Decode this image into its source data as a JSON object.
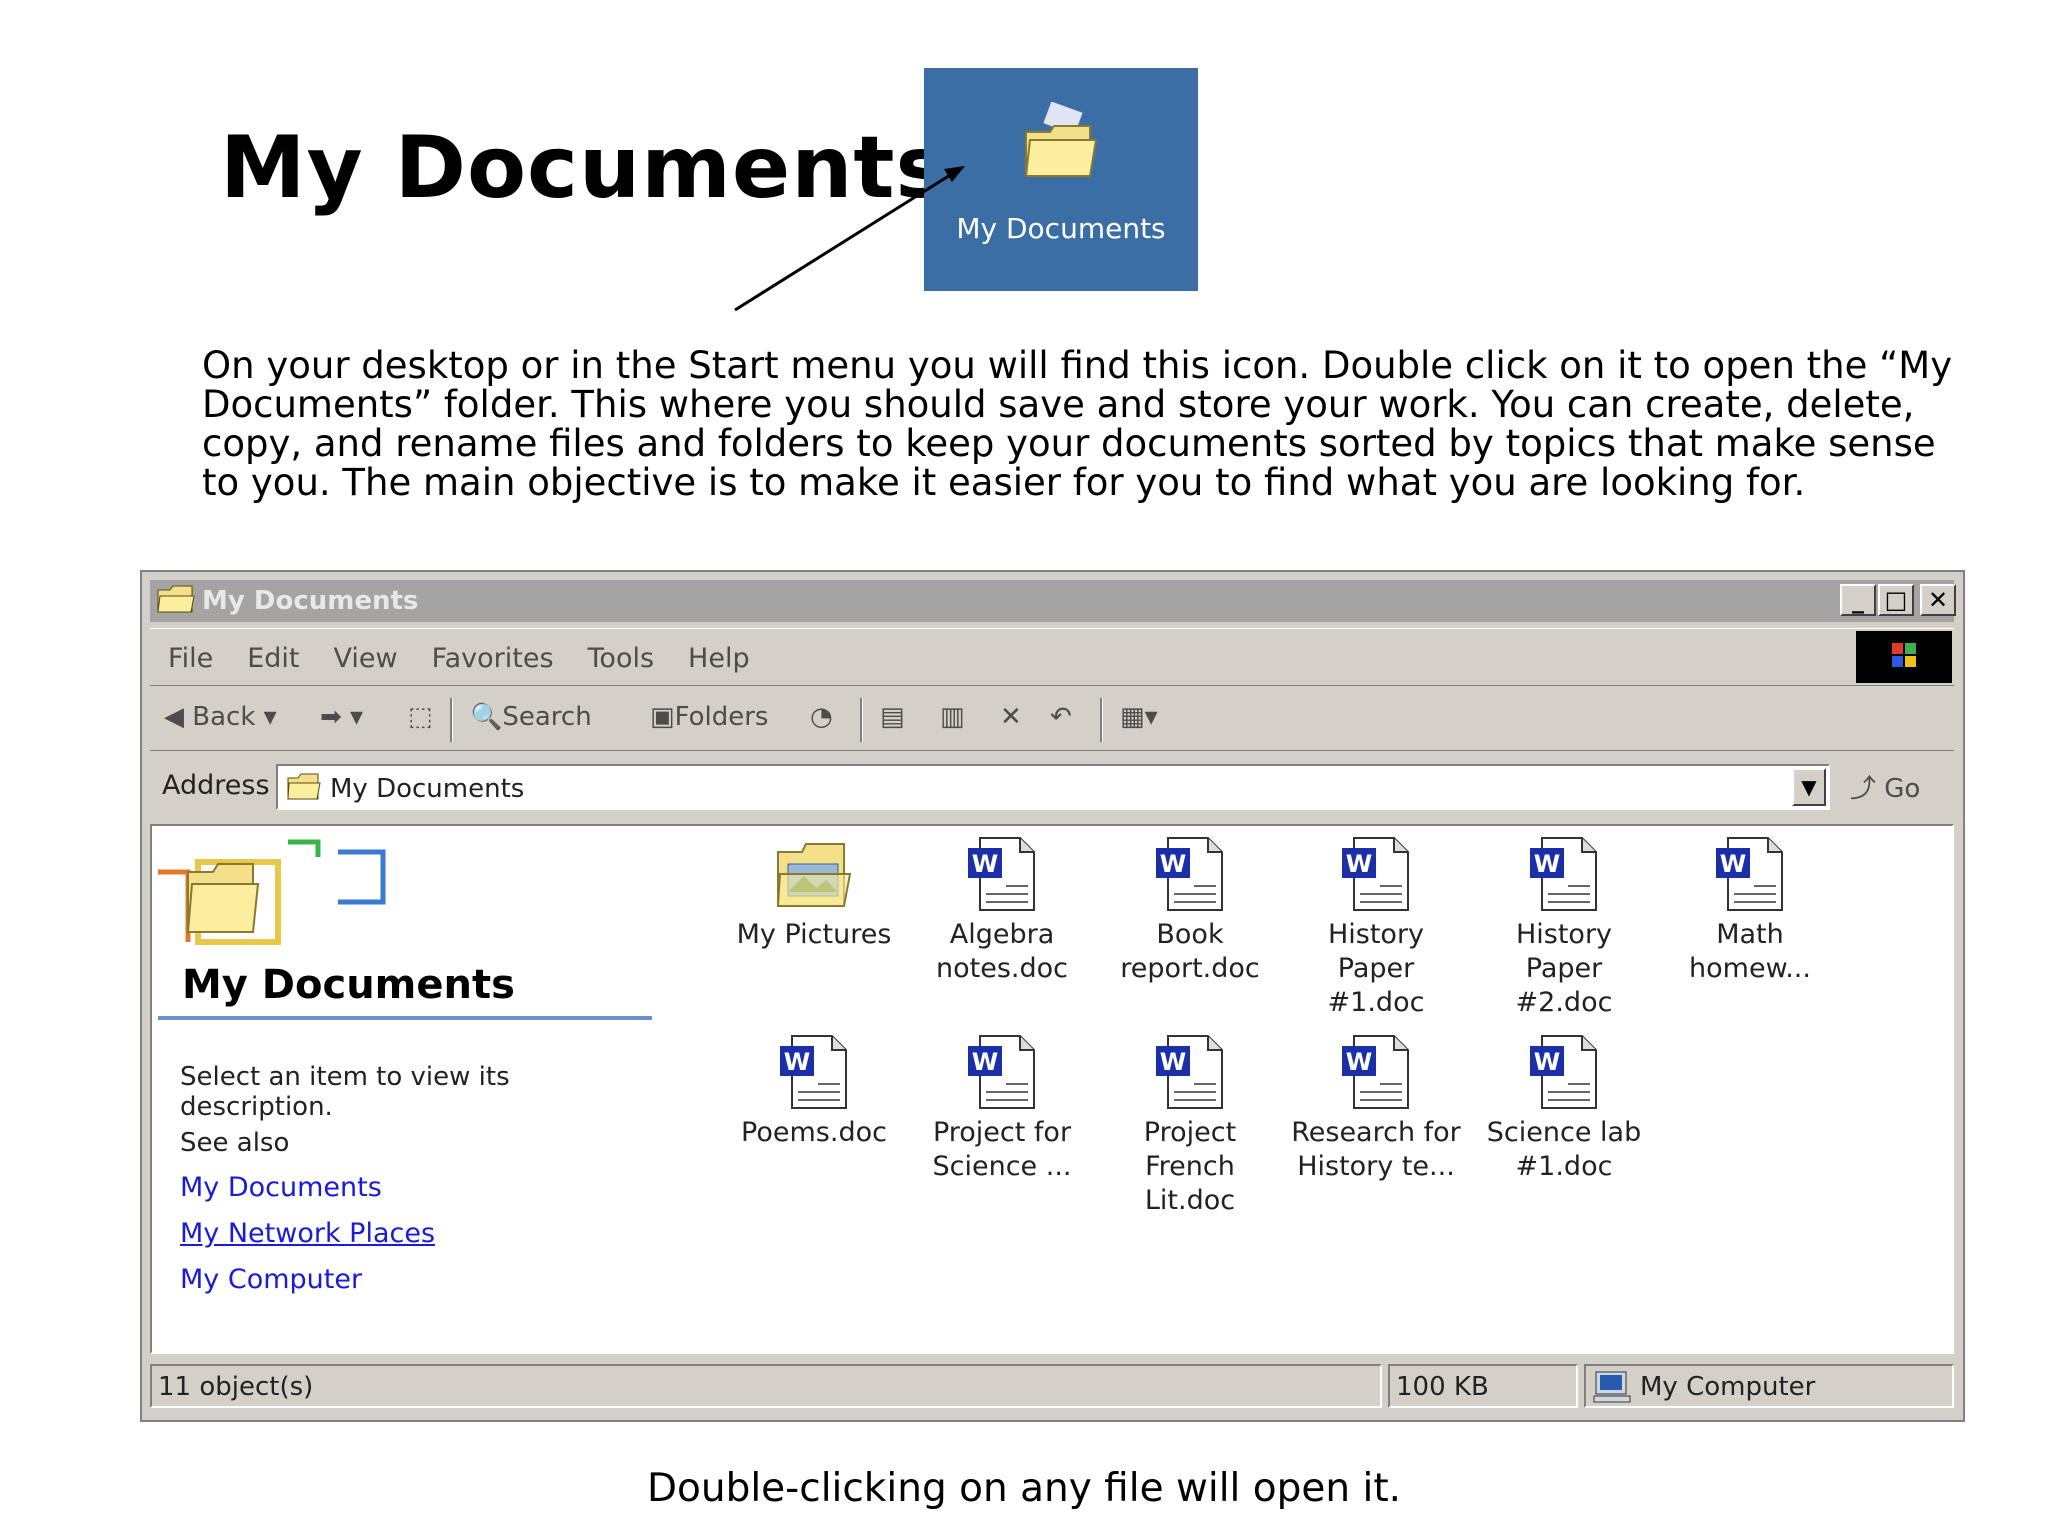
{
  "slide": {
    "title": "My Documents",
    "desktop_icon_label": "My Documents",
    "intro_lines": [
      "On your desktop or in the Start menu you will find this icon. Double click on it to open the “My",
      "Documents” folder.  This where you should save and store your work. You can create, delete,",
      "copy, and rename files and  folders to keep your documents sorted by topics that make sense",
      "to you. The main objective is to make it easier for you to find what you are looking for."
    ],
    "caption": "Double-clicking on any file will open it."
  },
  "window": {
    "title": "My Documents",
    "menu": [
      "File",
      "Edit",
      "View",
      "Favorites",
      "Tools",
      "Help"
    ],
    "toolbar": {
      "back": "Back",
      "search": "Search",
      "folders": "Folders"
    },
    "address": {
      "label": "Address",
      "value": "My Documents",
      "go": "Go"
    },
    "left_pane": {
      "title": "My Documents",
      "description": "Select an item to view its description.",
      "see_also": "See also",
      "links": [
        "My Documents",
        "My Network Places",
        "My Computer"
      ]
    },
    "files": [
      {
        "name": [
          "My Pictures",
          ""
        ],
        "type": "folder"
      },
      {
        "name": [
          "Algebra",
          "notes.doc"
        ],
        "type": "doc"
      },
      {
        "name": [
          "Book",
          "report.doc"
        ],
        "type": "doc"
      },
      {
        "name": [
          "History Paper",
          "#1.doc"
        ],
        "type": "doc"
      },
      {
        "name": [
          "History Paper",
          "#2.doc"
        ],
        "type": "doc"
      },
      {
        "name": [
          "Math",
          "homew..."
        ],
        "type": "doc"
      },
      {
        "name": [
          "Poems.doc",
          ""
        ],
        "type": "doc"
      },
      {
        "name": [
          "Project for",
          "Science ..."
        ],
        "type": "doc"
      },
      {
        "name": [
          "Project French",
          "Lit.doc"
        ],
        "type": "doc"
      },
      {
        "name": [
          "Research for",
          "History te..."
        ],
        "type": "doc"
      },
      {
        "name": [
          "Science lab",
          "#1.doc"
        ],
        "type": "doc"
      }
    ],
    "status": {
      "objects": "11 object(s)",
      "size": "100 KB",
      "zone": "My Computer"
    }
  },
  "colors": {
    "desktop_blue": "#3a6ea5",
    "link_blue": "#1a1adb",
    "word_blue": "#1a2fa8"
  }
}
